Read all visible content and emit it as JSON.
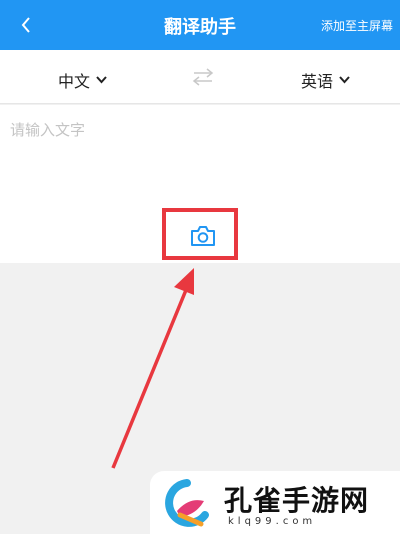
{
  "header": {
    "title": "翻译助手",
    "action_label": "添加至主屏幕",
    "back_icon": "chevron-left-icon",
    "background": "#2196f3"
  },
  "languages": {
    "source": "中文",
    "target": "英语",
    "swap_icon": "swap-arrows-icon"
  },
  "input": {
    "placeholder": "请输入文字",
    "value": "",
    "camera_icon": "camera-icon"
  },
  "annotation": {
    "color": "#e8383f"
  },
  "watermark": {
    "title": "孔雀手游网",
    "domain": "klq99.com"
  }
}
